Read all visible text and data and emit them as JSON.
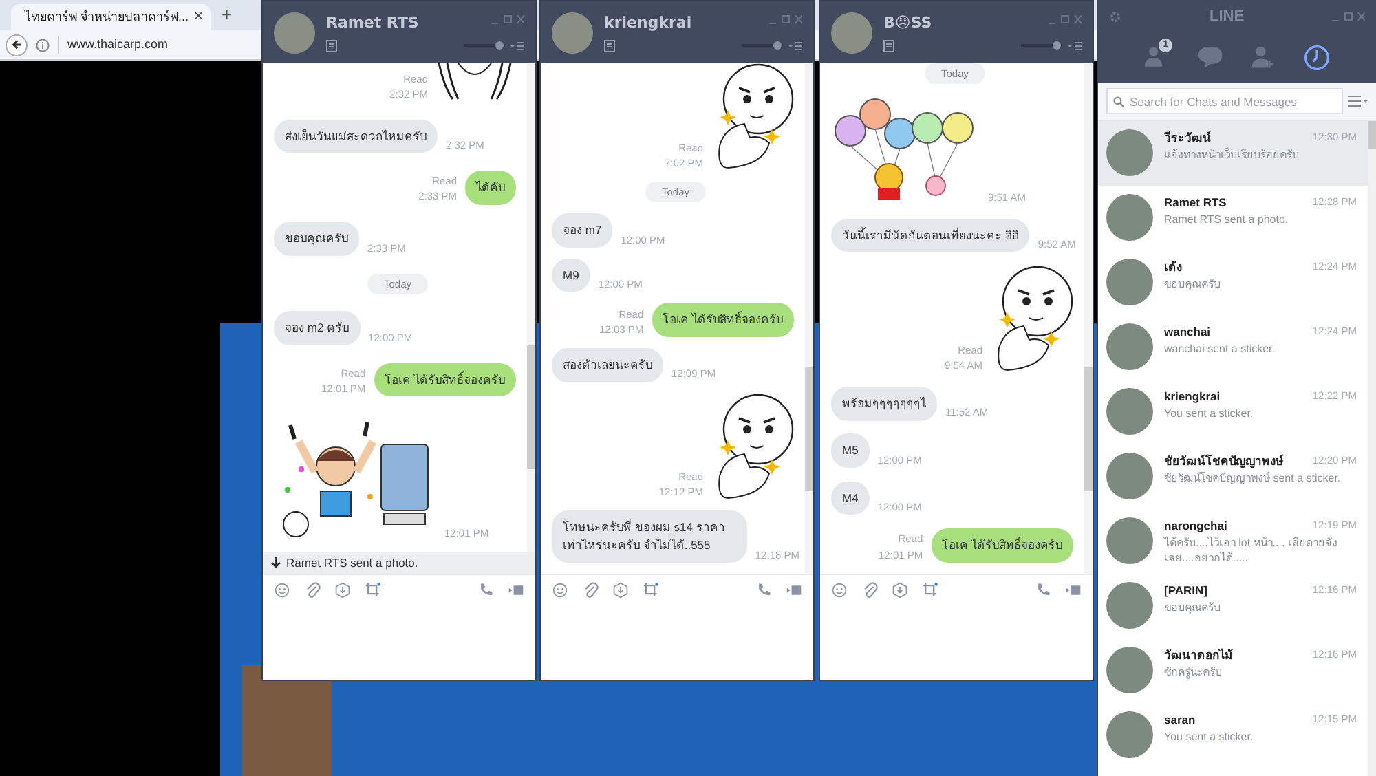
{
  "browser": {
    "tab_title": "ไทยคาร์ฟ จำหน่ายปลาคาร์ฟ...",
    "tab_close": "×",
    "new_tab": "+",
    "url": "www.thaicarp.com"
  },
  "chats": [
    {
      "name": "Ramet RTS",
      "opacity_slider": {
        "level": 0.85
      },
      "notice": "Ramet RTS sent a photo.",
      "messages": [
        {
          "kind": "head-sticker",
          "read": "Read",
          "time": "2:32 PM"
        },
        {
          "kind": "in",
          "text": "ส่งเย็นวันแม่สะดวกไหมครับ",
          "time": "2:32 PM"
        },
        {
          "kind": "out",
          "text": "ได้คับ",
          "read": "Read",
          "time": "2:33 PM"
        },
        {
          "kind": "in",
          "text": "ขอบคุณครับ",
          "time": "2:33 PM"
        },
        {
          "kind": "date",
          "text": "Today"
        },
        {
          "kind": "in",
          "text": "จอง m2 ครับ",
          "time": "12:00 PM"
        },
        {
          "kind": "out",
          "text": "โอเค ได้รับสิทธิ์จองครับ",
          "read": "Read",
          "time": "12:01 PM"
        },
        {
          "kind": "boy-sticker",
          "time": "12:01 PM"
        }
      ]
    },
    {
      "name": "kriengkrai",
      "opacity_slider": {
        "level": 0.85
      },
      "messages": [
        {
          "kind": "face-sticker",
          "read": "Read",
          "time": "7:02 PM"
        },
        {
          "kind": "date",
          "text": "Today"
        },
        {
          "kind": "in",
          "text": "จอง m7",
          "time": "12:00 PM"
        },
        {
          "kind": "in",
          "text": "M9",
          "time": "12:00 PM"
        },
        {
          "kind": "out",
          "text": "โอเค ได้รับสิทธิ์จองครับ",
          "read": "Read",
          "time": "12:03 PM"
        },
        {
          "kind": "in",
          "text": "สองตัวเลยนะครับ",
          "time": "12:09 PM"
        },
        {
          "kind": "face-sticker",
          "read": "Read",
          "time": "12:12 PM"
        },
        {
          "kind": "in",
          "text": "โทษนะครับพี่ ของผม s14 ราคาเท่าไหร่นะครับ จำไม่ได้..555",
          "time": "12:18 PM"
        }
      ]
    },
    {
      "name": "B😠SS",
      "opacity_slider": {
        "level": 0.85
      },
      "messages": [
        {
          "kind": "date",
          "text": "Today"
        },
        {
          "kind": "balloon-sticker",
          "time": "9:51 AM"
        },
        {
          "kind": "in",
          "text": "วันนี้เรามีนัดกันตอนเที่ยงนะคะ อิอิ",
          "time": "9:52 AM"
        },
        {
          "kind": "face-sticker",
          "read": "Read",
          "time": "9:54 AM"
        },
        {
          "kind": "in",
          "text": "พร้อมๆๆๆๆๆๆๆไ",
          "time": "11:52 AM"
        },
        {
          "kind": "in",
          "text": "M5",
          "time": "12:00 PM"
        },
        {
          "kind": "in",
          "text": "M4",
          "time": "12:00 PM"
        },
        {
          "kind": "out",
          "text": "โอเค ได้รับสิทธิ์จองครับ",
          "read": "Read",
          "time": "12:01 PM"
        }
      ]
    }
  ],
  "line": {
    "title": "LINE",
    "tabs": [
      {
        "kind": "friends",
        "badge": "1",
        "selected": false
      },
      {
        "kind": "chats",
        "selected": false
      },
      {
        "kind": "add-friend",
        "selected": false
      },
      {
        "kind": "recent",
        "selected": true
      }
    ],
    "search": {
      "placeholder": "Search for Chats and Messages"
    },
    "items": [
      {
        "name": "วีระวัฒน์",
        "preview": "แจ้งทางหน้าเว็บเรียบร้อยครับ",
        "time": "12:30 PM",
        "selected": true
      },
      {
        "name": "Ramet RTS",
        "preview": "Ramet RTS sent a photo.",
        "time": "12:28 PM",
        "selected": false
      },
      {
        "name": "เด้ง",
        "preview": "ขอบคุณครับ",
        "time": "12:24 PM",
        "selected": false
      },
      {
        "name": "wanchai",
        "preview": "wanchai sent a sticker.",
        "time": "12:24 PM",
        "selected": false
      },
      {
        "name": "kriengkrai",
        "preview": "You sent a sticker.",
        "time": "12:22 PM",
        "selected": false
      },
      {
        "name": "ชัยวัฒน์โชคปัญญาพงษ์",
        "preview": "ชัยวัฒน์โชคปัญญาพงษ์ sent a sticker.",
        "time": "12:20 PM",
        "selected": false
      },
      {
        "name": "narongchai",
        "preview": "ได้ครับ....ไว้เอา lot หน้า.... เสียดายจังเลย....อยากได้.....",
        "time": "12:19 PM",
        "selected": false
      },
      {
        "name": "[PARIN]",
        "preview": "ขอบคุณครับ",
        "time": "12:16 PM",
        "selected": false
      },
      {
        "name": "วัฒนาดอกไม้",
        "preview": "ซักครู่นะครับ",
        "time": "12:16 PM",
        "selected": false
      },
      {
        "name": "saran",
        "preview": "You sent a sticker.",
        "time": "12:15 PM",
        "selected": false
      }
    ]
  }
}
